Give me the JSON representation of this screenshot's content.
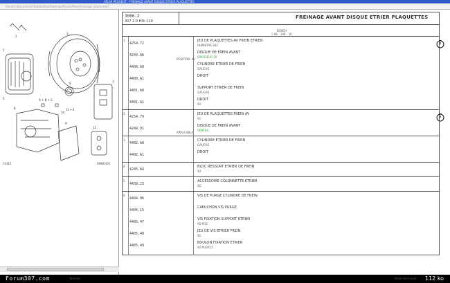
{
  "window": {
    "title": "ATLAS PEUGEOT - FREINAGE AVANT DISQUE ETRIER PLAQUETTES",
    "address": "file:///C:/Documents%20and%20Settings/Pieces/Frein/Freinage_avant.html"
  },
  "diagram": {
    "ref_left": "F4410",
    "ref_right": "09803/01",
    "callouts": [
      "1",
      "2",
      "3",
      "4",
      "5",
      "6",
      "7",
      "8",
      "9",
      "10",
      "11"
    ],
    "legend": [
      "A + B + C",
      "D + E"
    ]
  },
  "header": {
    "code": "3006-2",
    "model": "307 2.0 HDi 110",
    "title": "FREINAGE AVANT DISQUE ETRIER PLAQUETTES",
    "sub1": "BOSCH",
    "sub2": "F 96 - 106 - 10"
  },
  "sections": [
    {
      "ref": "1",
      "rows": [
        {
          "part": "4254.72",
          "desc": "JEU DE PLAQUETTES AV FREIN ETRIER",
          "sub": "DIAMETRE 283",
          "green": false
        },
        {
          "part": "4249.86",
          "desc": "DISQUE DE FREIN AVANT",
          "sub": "EPAISSEUR 26",
          "green": true,
          "note": "POSITION: AV"
        },
        {
          "part": "4400.A0",
          "desc": "CYLINDRE ETRIER DE FREIN",
          "sub": "GAUCHE",
          "green": false
        },
        {
          "part": "4400.A1",
          "desc": "DROIT",
          "sub": "",
          "green": false
        },
        {
          "part": "4401.A0",
          "desc": "SUPPORT ETRIER DE FREIN",
          "sub": "GAUCHE",
          "green": false
        },
        {
          "part": "4401.A1",
          "desc": "DROIT",
          "sub": "X2",
          "green": false
        }
      ]
    },
    {
      "ref": "2",
      "rows": [
        {
          "part": "4254.79",
          "desc": "JEU DE PLAQUETTES FREIN AV",
          "sub": "X1",
          "green": false
        },
        {
          "part": "4249.91",
          "desc": "DISQUE DE FREIN AVANT",
          "sub": "VENTILE",
          "green": true,
          "note": "APPLICABLE"
        }
      ]
    },
    {
      "ref": "3",
      "rows": [
        {
          "part": "4402.A0",
          "desc": "CYLINDRE ETRIER DE FREIN",
          "sub": "GAUCHE",
          "green": false
        },
        {
          "part": "4402.A1",
          "desc": "DROIT",
          "sub": "",
          "green": false
        }
      ]
    },
    {
      "ref": "4",
      "rows": [
        {
          "part": "4245.A4",
          "desc": "BLOC RESSORT ETRIER DE FREIN",
          "sub": "X2",
          "green": false
        }
      ]
    },
    {
      "ref": "5",
      "rows": [
        {
          "part": "4439.23",
          "desc": "ACCESSOIRE COLONNETTE ETRIER",
          "sub": "X2",
          "green": false
        }
      ]
    },
    {
      "ref": "6",
      "rows": [
        {
          "part": "4404.06",
          "desc": "VIS DE PURGE CYLINDRE DE FREIN",
          "sub": "",
          "green": false
        },
        {
          "part": "4404.15",
          "desc": "CAPUCHON VIS PURGE",
          "sub": "",
          "green": false
        },
        {
          "part": "4405.47",
          "desc": "VIS FIXATION SUPPORT ETRIER",
          "sub": "X2 M12",
          "green": false
        },
        {
          "part": "4405.48",
          "desc": "JEU DE VIS ETRIER FREIN",
          "sub": "X2",
          "green": false
        },
        {
          "part": "4405.49",
          "desc": "BOULON FIXATION ETRIER",
          "sub": "X2 M10X15",
          "green": false
        }
      ]
    }
  ],
  "status": {
    "brand": "Forum307.com",
    "left": "Termine",
    "mid": "Poste de travail",
    "size": "112 ko"
  }
}
